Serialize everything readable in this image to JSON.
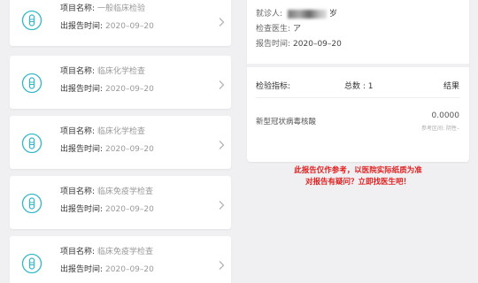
{
  "records": [
    {
      "name_label": "项目名称:",
      "name_value": "一般临床检验",
      "date_label": "出报告时间:",
      "date_value": "2020–09–20"
    },
    {
      "name_label": "项目名称:",
      "name_value": "临床化学检查",
      "date_label": "出报告时间:",
      "date_value": "2020–09–20"
    },
    {
      "name_label": "项目名称:",
      "name_value": "临床化学检查",
      "date_label": "出报告时间:",
      "date_value": "2020–09–20"
    },
    {
      "name_label": "项目名称:",
      "name_value": "临床免疫学检查",
      "date_label": "出报告时间:",
      "date_value": "2020–09–20"
    },
    {
      "name_label": "项目名称:",
      "name_value": "临床免疫学检查",
      "date_label": "出报告时间:",
      "date_value": "2020–09–20"
    }
  ],
  "report": {
    "patient_label": "就诊人:",
    "patient_suffix": "岁",
    "doctor_label": "检查医生:",
    "doctor_value": "ア",
    "date_label": "报告时间:",
    "date_value": "2020–09–20",
    "table": {
      "col_indicator": "检验指标:",
      "col_total": "总数 : 1",
      "col_result": "结果"
    },
    "item": {
      "name": "新型冠状病毒核酸",
      "value": "0.0000",
      "ref_label": "参考区间:",
      "ref_value": "阴性–"
    }
  },
  "notice": {
    "line1": "此报告仅作参考，以医院实际纸质为准",
    "line2": "对报告有疑问？立即找医生吧！"
  },
  "colors": {
    "accent": "#2fb8c8",
    "warning": "#e02020"
  }
}
